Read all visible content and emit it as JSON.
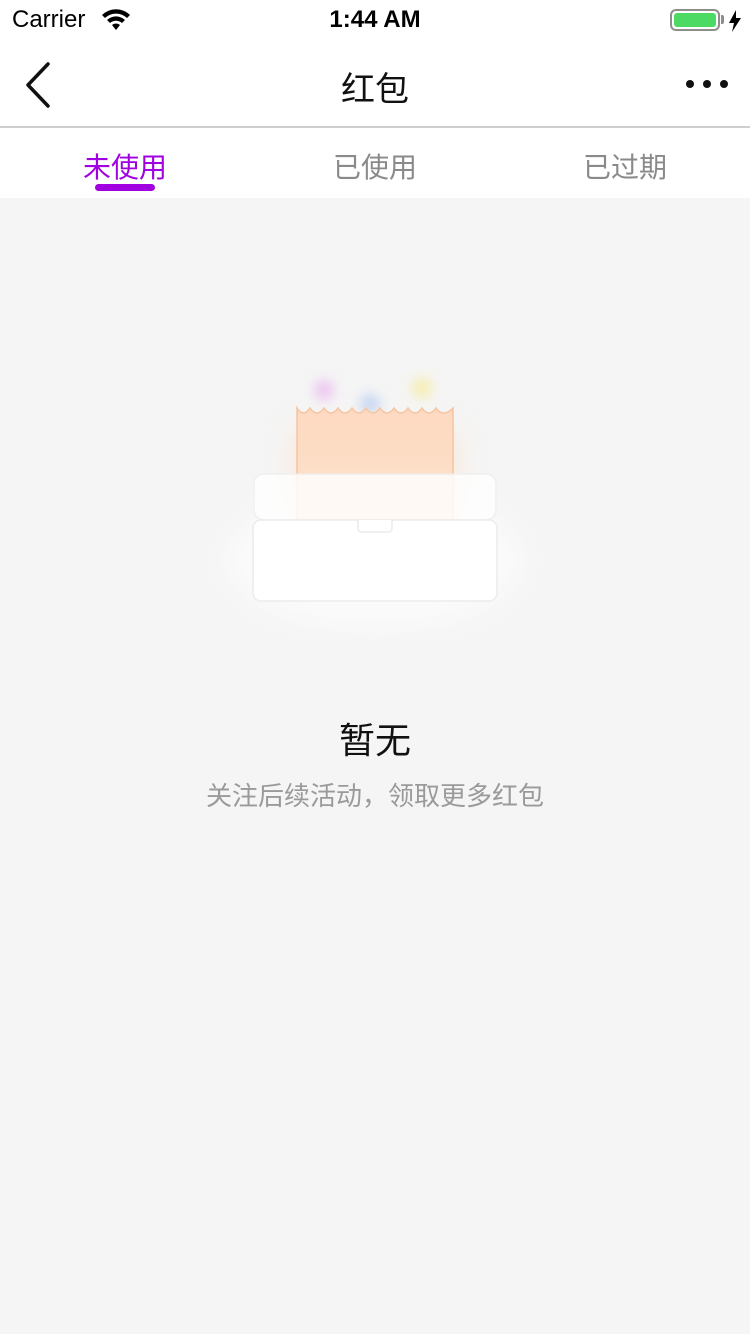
{
  "status_bar": {
    "carrier": "Carrier",
    "time": "1:44 AM",
    "battery_color": "#4cd964"
  },
  "nav": {
    "title": "红包",
    "back_icon": "chevron-left-icon",
    "more_icon": "more-dots-icon"
  },
  "tabs": [
    {
      "label": "未使用",
      "active": true
    },
    {
      "label": "已使用",
      "active": false
    },
    {
      "label": "已过期",
      "active": false
    }
  ],
  "accent_color": "#a100e0",
  "empty_state": {
    "illustration": "empty-box-illustration",
    "title": "暂无",
    "description": "关注后续活动，领取更多红包"
  }
}
